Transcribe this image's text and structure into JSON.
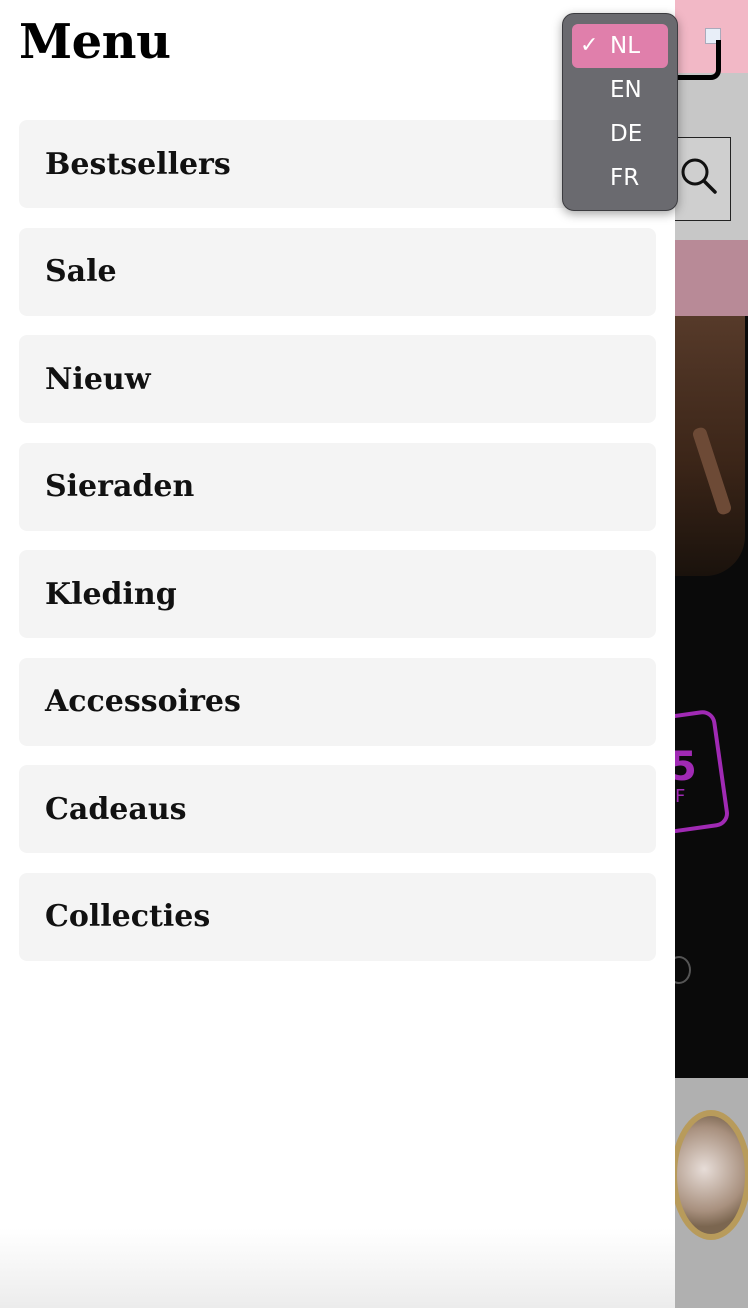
{
  "drawer": {
    "title": "Menu",
    "items": [
      {
        "label": "Bestsellers"
      },
      {
        "label": "Sale"
      },
      {
        "label": "Nieuw"
      },
      {
        "label": "Sieraden"
      },
      {
        "label": "Kleding"
      },
      {
        "label": "Accessoires"
      },
      {
        "label": "Cadeaus"
      },
      {
        "label": "Collecties"
      }
    ]
  },
  "language_dropdown": {
    "selected": "NL",
    "check_mark": "✓",
    "options": [
      {
        "label": "NL"
      },
      {
        "label": "EN"
      },
      {
        "label": "DE"
      },
      {
        "label": "FR"
      }
    ]
  },
  "background_page": {
    "neon_text_large": "5",
    "neon_text_small": "F"
  },
  "colors": {
    "selection_pink": "#e07fab",
    "topbar_pink": "#f2b8c6",
    "neon_purple": "#a02ab4",
    "menu_item_bg": "#f4f4f4"
  }
}
